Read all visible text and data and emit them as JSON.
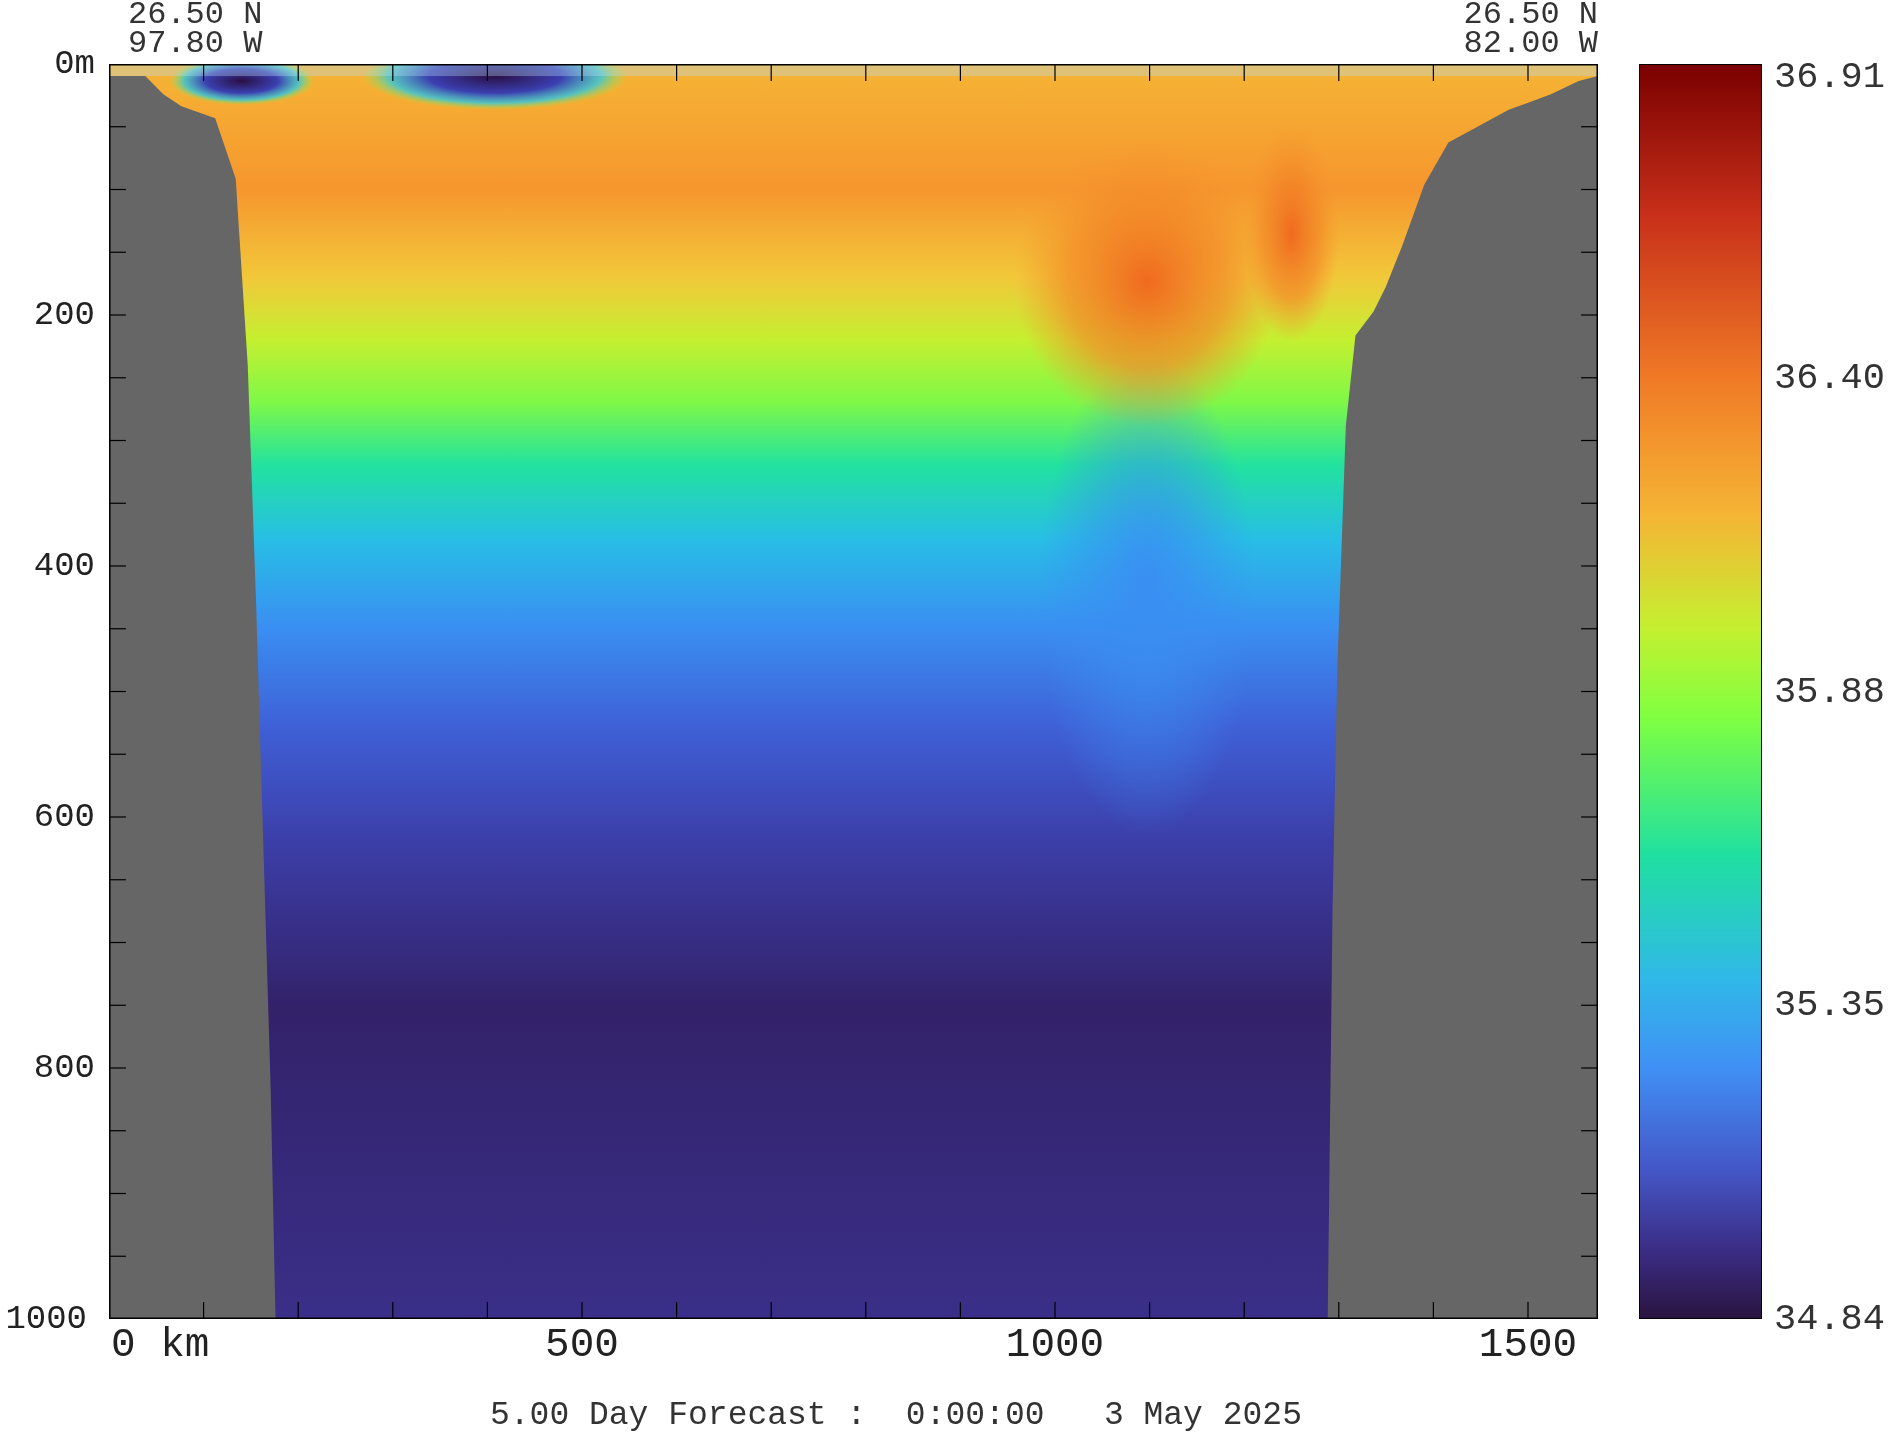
{
  "top_left": {
    "lat": "26.50 N",
    "lon": "97.80 W"
  },
  "top_right": {
    "lat": "26.50 N",
    "lon": "82.00 W"
  },
  "y_axis": {
    "labels": [
      "0m",
      "200",
      "400",
      "600",
      "800",
      "1000"
    ]
  },
  "x_axis": {
    "labels": [
      "0 km",
      "500",
      "1000",
      "1500"
    ]
  },
  "colorbar": {
    "labels": [
      "36.91",
      "36.40",
      "35.88",
      "35.35",
      "34.84"
    ]
  },
  "title": "5.00 Day Forecast :  0:00:00   3 May 2025"
}
